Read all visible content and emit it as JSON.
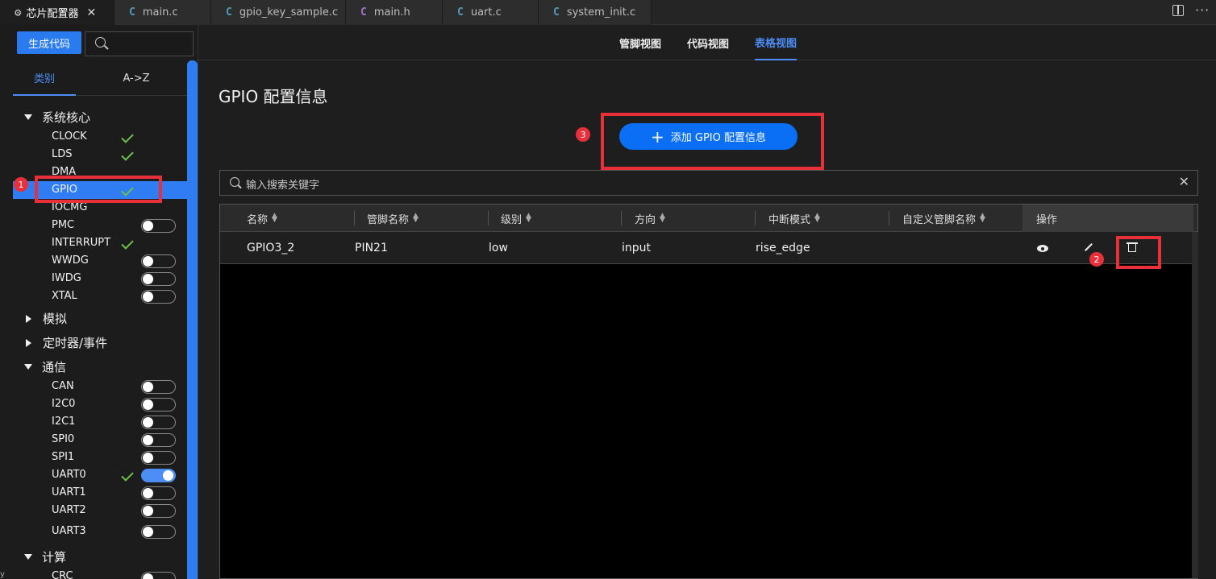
{
  "tabs": [
    {
      "label": "芯片配置器",
      "icon": "chip-icon",
      "active": true
    },
    {
      "label": "main.c",
      "icon": "C"
    },
    {
      "label": "gpio_key_sample.c",
      "icon": "C"
    },
    {
      "label": "main.h",
      "icon": "C"
    },
    {
      "label": "uart.c",
      "icon": "C"
    },
    {
      "label": "system_init.c",
      "icon": "C"
    }
  ],
  "sidebar": {
    "generate_label": "生成代码",
    "tabs": [
      "类别",
      "A->Z"
    ],
    "groups": [
      {
        "label": "系统核心",
        "expanded": true
      },
      {
        "label": "模拟",
        "expanded": false
      },
      {
        "label": "定时器/事件",
        "expanded": false
      },
      {
        "label": "通信",
        "expanded": true
      },
      {
        "label": "计算",
        "expanded": true
      }
    ],
    "core_items": [
      {
        "label": "CLOCK",
        "state": "check"
      },
      {
        "label": "LDS",
        "state": "check"
      },
      {
        "label": "DMA",
        "state": "none"
      },
      {
        "label": "GPIO",
        "state": "check",
        "selected": true
      },
      {
        "label": "IOCMG",
        "state": "none"
      },
      {
        "label": "PMC",
        "state": "toggle-off"
      },
      {
        "label": "INTERRUPT",
        "state": "check"
      },
      {
        "label": "WWDG",
        "state": "toggle-off"
      },
      {
        "label": "IWDG",
        "state": "toggle-off"
      },
      {
        "label": "XTAL",
        "state": "toggle-off"
      }
    ],
    "comm_items": [
      {
        "label": "CAN",
        "state": "toggle-off"
      },
      {
        "label": "I2C0",
        "state": "toggle-off"
      },
      {
        "label": "I2C1",
        "state": "toggle-off"
      },
      {
        "label": "SPI0",
        "state": "toggle-off"
      },
      {
        "label": "SPI1",
        "state": "toggle-off"
      },
      {
        "label": "UART0",
        "state": "check+toggle-on"
      },
      {
        "label": "UART1",
        "state": "toggle-off"
      },
      {
        "label": "UART2",
        "state": "toggle-off"
      },
      {
        "label": "UART3",
        "state": "toggle-off"
      }
    ],
    "compute_items": [
      {
        "label": "CRC",
        "state": "toggle-off"
      }
    ]
  },
  "view_tabs": [
    "管脚视图",
    "代码视图",
    "表格视图"
  ],
  "main": {
    "title": "GPIO 配置信息",
    "add_label": "添加 GPIO 配置信息",
    "search_placeholder": "输入搜索关键字",
    "columns": [
      "名称",
      "管脚名称",
      "级别",
      "方向",
      "中断模式",
      "自定义管脚名称",
      "操作"
    ],
    "rows": [
      {
        "name": "GPIO3_2",
        "pin": "PIN21",
        "level": "low",
        "direction": "input",
        "interrupt": "rise_edge",
        "custom": ""
      }
    ]
  },
  "annotations": [
    "1",
    "2",
    "3"
  ],
  "edge_text": "y",
  "colors": {
    "accent": "#2f7cf3",
    "highlight": "#e8303a",
    "check": "#6fbf4a"
  }
}
